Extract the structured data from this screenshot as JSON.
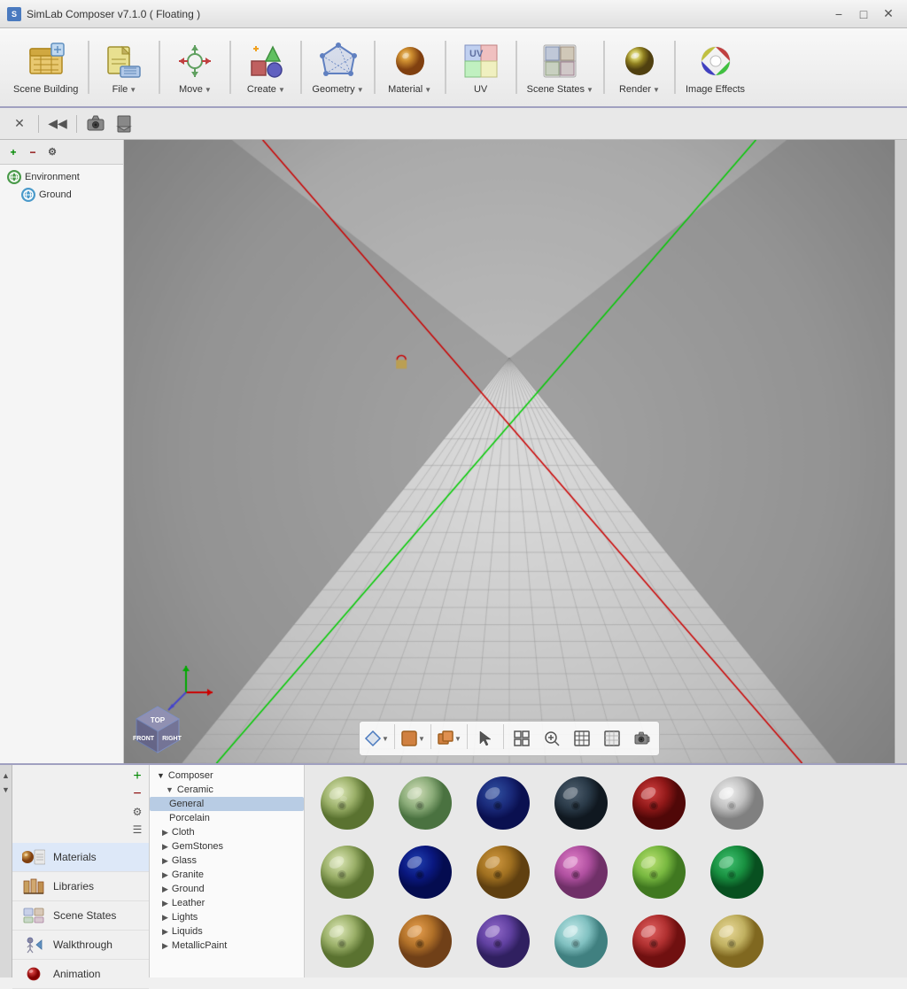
{
  "app": {
    "title": "SimLab Composer v7.1.0 ( Floating )"
  },
  "toolbar": {
    "items": [
      {
        "id": "scene-building",
        "label": "Scene Building",
        "icon": "🔧",
        "has_arrow": false
      },
      {
        "id": "file",
        "label": "File",
        "icon": "📁",
        "has_arrow": true
      },
      {
        "id": "move",
        "label": "Move",
        "icon": "✛",
        "has_arrow": true
      },
      {
        "id": "create",
        "label": "Create",
        "icon": "🎲",
        "has_arrow": true
      },
      {
        "id": "geometry",
        "label": "Geometry",
        "icon": "⬡",
        "has_arrow": true
      },
      {
        "id": "material",
        "label": "Material",
        "icon": "🎨",
        "has_arrow": true
      },
      {
        "id": "uv",
        "label": "UV",
        "icon": "⊞",
        "has_arrow": false
      },
      {
        "id": "scene-states",
        "label": "Scene States",
        "icon": "🖼",
        "has_arrow": true
      },
      {
        "id": "render",
        "label": "Render",
        "icon": "⚽",
        "has_arrow": true
      },
      {
        "id": "image-effects",
        "label": "Image Effects",
        "icon": "🌈",
        "has_arrow": false
      }
    ]
  },
  "scene_tree": {
    "items": [
      {
        "label": "Environment",
        "icon_color": "#4a9a4a",
        "indent": 0
      },
      {
        "label": "Ground",
        "icon_color": "#4a9aca",
        "indent": 1
      }
    ]
  },
  "nav_panel": {
    "items": [
      {
        "id": "materials",
        "label": "Materials",
        "active": true
      },
      {
        "id": "libraries",
        "label": "Libraries",
        "active": false
      },
      {
        "id": "scene-states",
        "label": "Scene States",
        "active": false
      },
      {
        "id": "walkthrough",
        "label": "Walkthrough",
        "active": false
      },
      {
        "id": "animation",
        "label": "Animation",
        "active": false
      }
    ]
  },
  "materials_tree": {
    "root": "Composer",
    "items": [
      {
        "label": "Ceramic",
        "expanded": true,
        "indent": 1
      },
      {
        "label": "General",
        "indent": 2,
        "selected": true
      },
      {
        "label": "Porcelain",
        "indent": 2,
        "selected": false
      },
      {
        "label": "Cloth",
        "indent": 1,
        "expanded": false
      },
      {
        "label": "GemStones",
        "indent": 1,
        "expanded": false
      },
      {
        "label": "Glass",
        "indent": 1,
        "expanded": false
      },
      {
        "label": "Granite",
        "indent": 1,
        "expanded": false
      },
      {
        "label": "Ground",
        "indent": 1,
        "expanded": false
      },
      {
        "label": "Leather",
        "indent": 1,
        "expanded": false
      },
      {
        "label": "Lights",
        "indent": 1,
        "expanded": false
      },
      {
        "label": "Liquids",
        "indent": 1,
        "expanded": false
      },
      {
        "label": "MetallicPaint",
        "indent": 1,
        "expanded": false
      }
    ]
  },
  "material_swatches": {
    "rows": [
      [
        {
          "color1": "#c8d4a0",
          "color2": "#8a9a60"
        },
        {
          "color1": "#b8c8a0",
          "color2": "#7a9a70"
        },
        {
          "color1": "#1a2a6a",
          "color2": "#0a1a5a"
        },
        {
          "color1": "#2a3a4a",
          "color2": "#1a2a3a"
        },
        {
          "color1": "#9a1a1a",
          "color2": "#6a0a0a"
        },
        {
          "color1": "#e0e0e0",
          "color2": "#a0a0a0"
        }
      ],
      [
        {
          "color1": "#c8d4a0",
          "color2": "#8a9a60"
        },
        {
          "color1": "#0a1a8a",
          "color2": "#050d5a"
        },
        {
          "color1": "#8a6020",
          "color2": "#604010"
        },
        {
          "color1": "#c060a0",
          "color2": "#904080"
        },
        {
          "color1": "#a0d060",
          "color2": "#60a040"
        },
        {
          "color1": "#208040",
          "color2": "#105020"
        }
      ],
      [
        {
          "color1": "#c8d4a0",
          "color2": "#8a9a60"
        },
        {
          "color1": "#d08030",
          "color2": "#a06020"
        },
        {
          "color1": "#6040a0",
          "color2": "#402060"
        },
        {
          "color1": "#a0d0d0",
          "color2": "#60a0a0"
        },
        {
          "color1": "#d04040",
          "color2": "#a02020"
        },
        {
          "color1": "#d0c080",
          "color2": "#a09040"
        }
      ]
    ]
  },
  "viewport_toolbar": {
    "buttons": [
      {
        "id": "view-nav",
        "icon": "⬡",
        "has_arrow": true
      },
      {
        "id": "surface-mode",
        "icon": "□",
        "has_arrow": true
      },
      {
        "id": "object-mode",
        "icon": "▣",
        "has_arrow": true
      },
      {
        "id": "select",
        "icon": "↖",
        "has_arrow": false
      },
      {
        "id": "snap",
        "icon": "◫",
        "has_arrow": false
      },
      {
        "id": "zoom-fit",
        "icon": "⊕",
        "has_arrow": false
      },
      {
        "id": "grid",
        "icon": "⊞",
        "has_arrow": false
      },
      {
        "id": "grid2",
        "icon": "⊟",
        "has_arrow": false
      },
      {
        "id": "camera",
        "icon": "📷",
        "has_arrow": false
      }
    ]
  },
  "colors": {
    "title_bar_bg": "#f0f0f0",
    "toolbar_bg": "#f0eeee",
    "viewport_bg": "#c8c8c8",
    "accent": "#7090c8",
    "selected_mat": "#b8cce4"
  }
}
